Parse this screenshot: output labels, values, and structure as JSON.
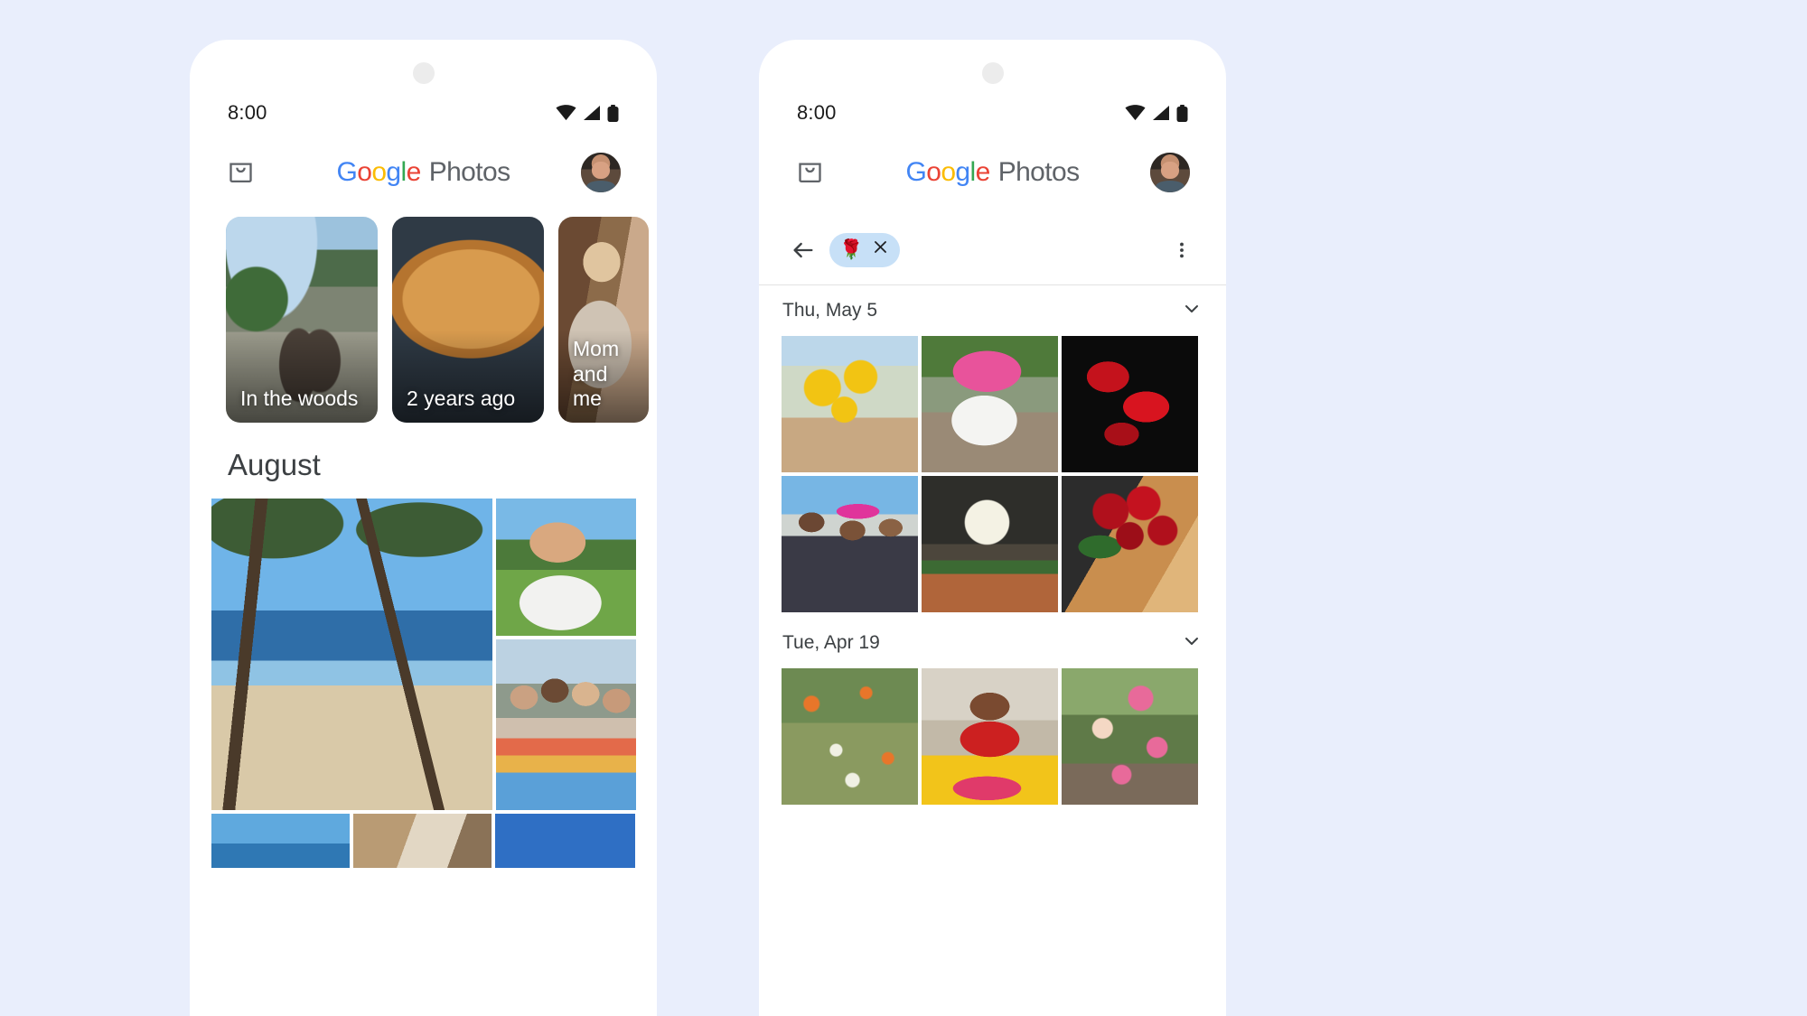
{
  "background_color": "#e9eefc",
  "phones": [
    {
      "id": "left",
      "name": "google-photos-home",
      "status": {
        "time": "8:00",
        "icons": [
          "wifi-icon",
          "signal-icon",
          "battery-icon"
        ]
      },
      "appbar": {
        "store_icon": "shopping-bag-icon",
        "wordmark": {
          "g1": "G",
          "o1": "o",
          "o2": "o",
          "g2": "g",
          "l1": "l",
          "e1": "e",
          "photos": "Photos"
        },
        "avatar": "account-avatar"
      },
      "memories": [
        {
          "label": "In the woods",
          "name": "memory-card-in-the-woods"
        },
        {
          "label": "2 years ago",
          "name": "memory-card-2-years-ago"
        },
        {
          "label": "Mom and me",
          "name": "memory-card-mom-and-me"
        }
      ],
      "month_title": "August"
    },
    {
      "id": "right",
      "name": "google-photos-search-results",
      "status": {
        "time": "8:00",
        "icons": [
          "wifi-icon",
          "signal-icon",
          "battery-icon"
        ]
      },
      "appbar": {
        "store_icon": "shopping-bag-icon",
        "wordmark": {
          "g1": "G",
          "o1": "o",
          "o2": "o",
          "g2": "g",
          "l1": "l",
          "e1": "e",
          "photos": "Photos"
        },
        "avatar": "account-avatar"
      },
      "search": {
        "back_icon": "arrow-back-icon",
        "chip_emoji": "🌹",
        "chip_clear_icon": "close-icon",
        "chip_color": "#c7e0f7",
        "overflow_icon": "more-vert-icon"
      },
      "sections": [
        {
          "date": "Thu, May 5",
          "expand_icon": "chevron-down-icon",
          "photos": [
            "sunflowers-in-vase",
            "pink-hydrangea-in-white-pot",
            "red-tulips-on-black",
            "three-people-with-flowers",
            "white-zinnia-in-pot",
            "red-roses-bouquet"
          ]
        },
        {
          "date": "Tue, Apr 19",
          "expand_icon": "chevron-down-icon",
          "photos": [
            "wildflower-meadow",
            "woman-in-red-with-flowers",
            "pink-roses-on-trellis"
          ]
        }
      ]
    }
  ],
  "brand_colors": {
    "blue": "#4285F4",
    "red": "#EA4335",
    "yellow": "#FBBC05",
    "green": "#34A853",
    "grey_text": "#5f6368"
  }
}
